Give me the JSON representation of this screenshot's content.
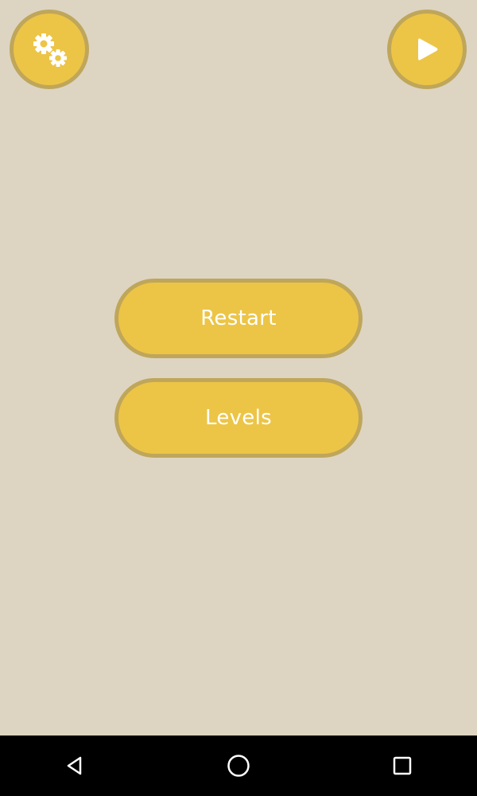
{
  "header": {
    "settings_icon": "gears-icon",
    "play_icon": "play-icon"
  },
  "menu": {
    "restart_label": "Restart",
    "levels_label": "Levels"
  },
  "navbar": {
    "back_icon": "back-triangle-icon",
    "home_icon": "home-circle-icon",
    "recents_icon": "recents-square-icon"
  },
  "colors": {
    "background": "#ddd5c2",
    "button_fill": "#ecc547",
    "button_border": "#bfa65a",
    "button_text": "#ffffff",
    "navbar": "#000000"
  }
}
